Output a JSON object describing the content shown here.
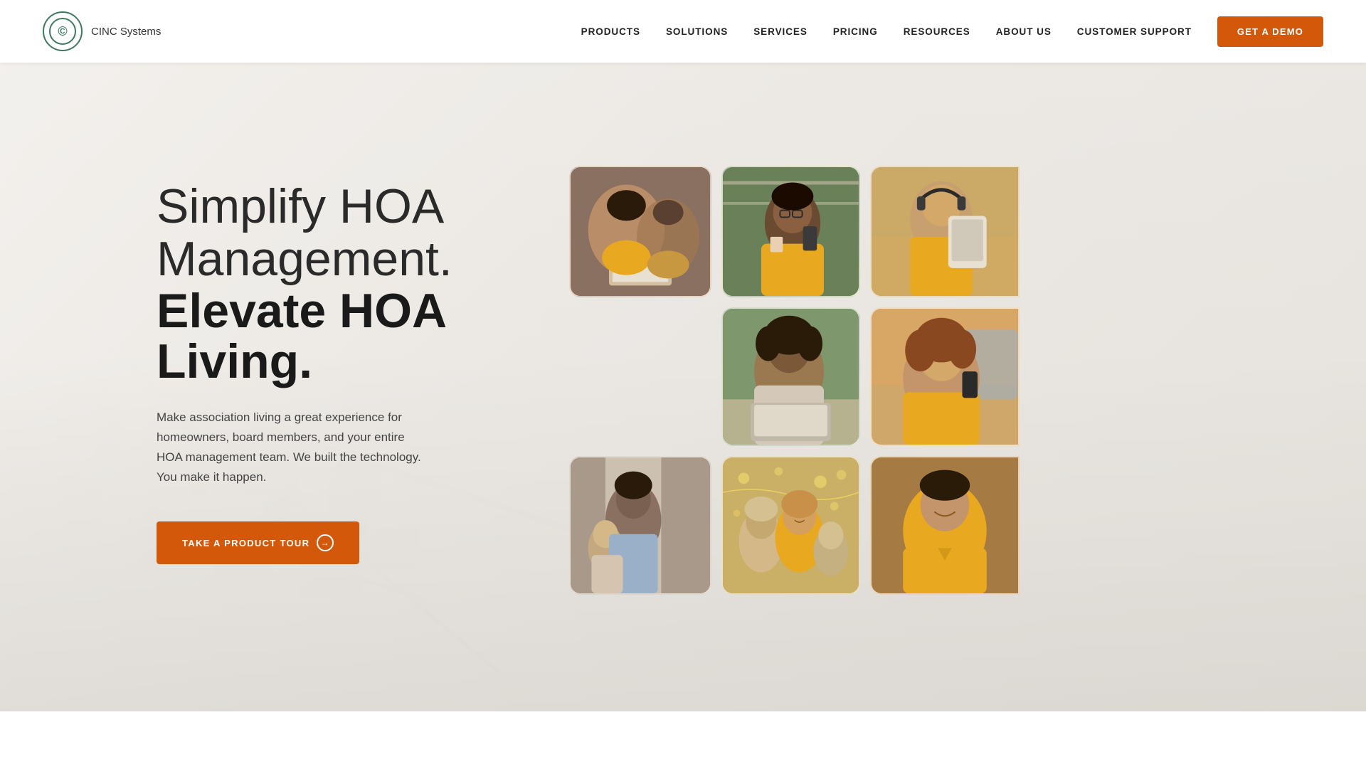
{
  "nav": {
    "brand": "CINC Systems",
    "links": [
      {
        "id": "products",
        "label": "PRODUCTS"
      },
      {
        "id": "solutions",
        "label": "SOLUTIONS"
      },
      {
        "id": "services",
        "label": "SERVICES"
      },
      {
        "id": "pricing",
        "label": "PRICING"
      },
      {
        "id": "resources",
        "label": "RESOURCES"
      },
      {
        "id": "about-us",
        "label": "ABOUT US"
      },
      {
        "id": "customer-support",
        "label": "CUSTOMER SUPPORT"
      }
    ],
    "cta": "GET A DEMO"
  },
  "hero": {
    "title_light": "Simplify HOA\nManagement.",
    "title_bold": "Elevate HOA\nLiving.",
    "description": "Make association living a great experience for homeowners, board members, and your entire HOA management team. We built the technology. You make it happen.",
    "cta": "TAKE A PRODUCT TOUR",
    "photos": [
      {
        "id": "photo-1",
        "alt": "Two women looking at laptop together"
      },
      {
        "id": "photo-2",
        "alt": "Woman holding coffee and phone"
      },
      {
        "id": "photo-3",
        "alt": "Person with headphones using tablet"
      },
      {
        "id": "photo-4",
        "alt": "Woman working on laptop on couch"
      },
      {
        "id": "photo-5",
        "alt": "Woman smiling at phone on couch"
      },
      {
        "id": "photo-6",
        "alt": "Parent and child by window"
      },
      {
        "id": "photo-7",
        "alt": "Family gathering with lights"
      },
      {
        "id": "photo-8",
        "alt": "Man in yellow shirt smiling"
      }
    ]
  },
  "colors": {
    "primary_orange": "#d4580a",
    "dark_green": "#3d7a5e",
    "text_dark": "#1a1a1a",
    "text_medium": "#444"
  }
}
